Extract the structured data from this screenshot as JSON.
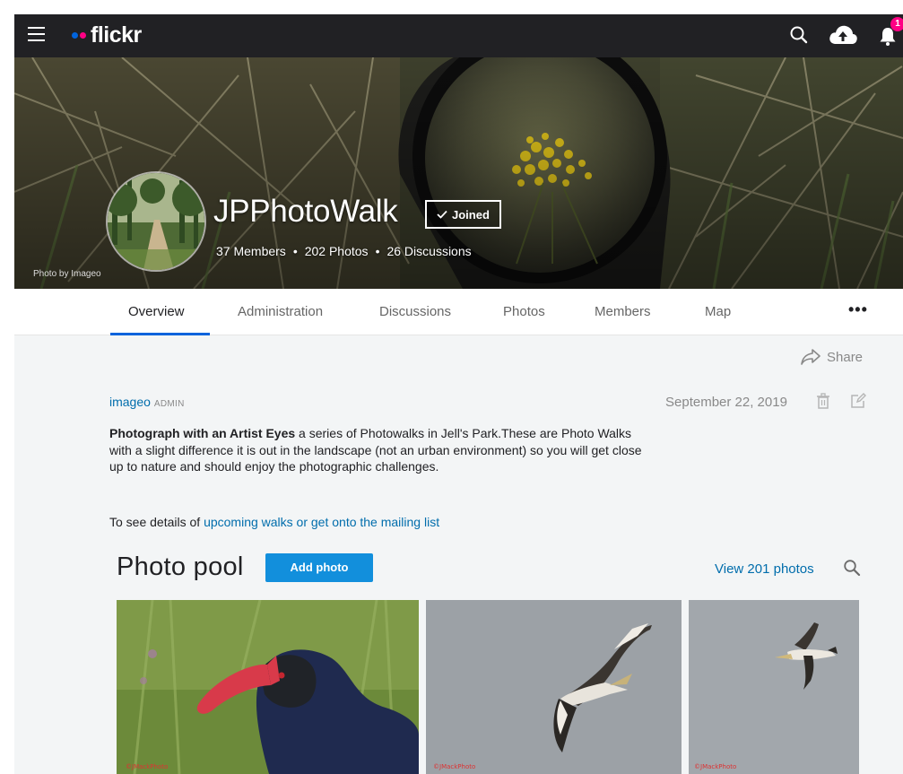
{
  "nav": {
    "logo_text": "flickr",
    "notification_count": "1",
    "icons": [
      "menu-icon",
      "search-icon",
      "upload-cloud-icon",
      "bell-icon"
    ]
  },
  "group": {
    "cover_credit": "Photo by Imageo",
    "title": "JPPhotoWalk",
    "joined_label": "Joined",
    "members": "37 Members",
    "photos": "202 Photos",
    "discussions": "26 Discussions",
    "stat_separator": "•"
  },
  "tabs": [
    {
      "label": "Overview",
      "active": true
    },
    {
      "label": "Administration",
      "active": false
    },
    {
      "label": "Discussions",
      "active": false
    },
    {
      "label": "Photos",
      "active": false
    },
    {
      "label": "Members",
      "active": false
    },
    {
      "label": "Map",
      "active": false
    }
  ],
  "more_label": "•••",
  "overview": {
    "share_label": "Share",
    "author": "imageo",
    "author_role": "ADMIN",
    "date": "September 22, 2019",
    "description_bold": "Photograph with an Artist Eyes",
    "description_rest": " a series of Photowalks in Jell's Park.These are Photo Walks with a slight difference it is out in the landscape (not an urban environment) so you will get close up to nature and should enjoy the photographic challenges.",
    "walks_prefix": "To see details of ",
    "walks_link": "upcoming walks or get onto the mailing list"
  },
  "pool": {
    "title": "Photo pool",
    "add_label": "Add photo",
    "view_label": "View 201 photos",
    "watermark": "©JMackPhoto"
  },
  "colors": {
    "nav_bg": "#212124",
    "accent_blue": "#0063dc",
    "button_blue": "#128fdc",
    "link_blue": "#006dac",
    "badge_pink": "#ff0084",
    "page_bg": "#f3f5f6"
  }
}
